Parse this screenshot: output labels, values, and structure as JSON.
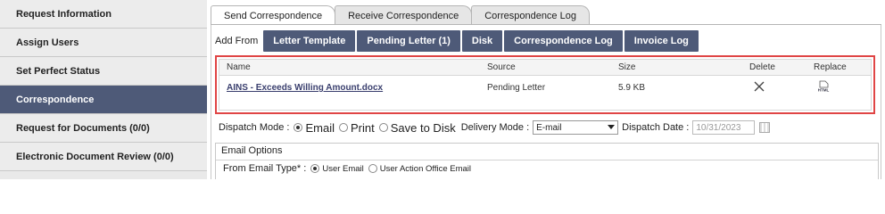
{
  "sidebar": {
    "items": [
      {
        "label": "Request Information"
      },
      {
        "label": "Assign Users"
      },
      {
        "label": "Set Perfect Status"
      },
      {
        "label": "Correspondence"
      },
      {
        "label": "Request for Documents (0/0)"
      },
      {
        "label": "Electronic Document Review (0/0)"
      }
    ],
    "active_index": 3
  },
  "tabs": [
    {
      "label": "Send Correspondence"
    },
    {
      "label": "Receive Correspondence"
    },
    {
      "label": "Correspondence Log"
    }
  ],
  "add_from": {
    "label": "Add From",
    "buttons": [
      {
        "label": "Letter Template"
      },
      {
        "label": "Pending Letter (1)"
      },
      {
        "label": "Disk"
      },
      {
        "label": "Correspondence Log"
      },
      {
        "label": "Invoice Log"
      }
    ]
  },
  "file_table": {
    "headers": {
      "name": "Name",
      "source": "Source",
      "size": "Size",
      "delete": "Delete",
      "replace": "Replace"
    },
    "rows": [
      {
        "name": "AINS - Exceeds Willing Amount.docx",
        "source": "Pending Letter",
        "size": "5.9 KB",
        "replace_icon_text": "HTML"
      }
    ]
  },
  "dispatch": {
    "mode_label": "Dispatch Mode :",
    "modes": [
      "Email",
      "Print",
      "Save to Disk"
    ],
    "selected_mode": "Email",
    "delivery_label": "Delivery Mode :",
    "delivery_value": "E-mail",
    "date_label": "Dispatch Date :",
    "date_value": "10/31/2023"
  },
  "email_options": {
    "title": "Email Options",
    "from_label": "From Email Type* :",
    "types": [
      "User Email",
      "User Action Office Email"
    ],
    "selected_type": "User Email"
  },
  "colors": {
    "accent": "#4e5a78",
    "highlight_border": "#e04545",
    "sidebar_bg": "#ececec"
  }
}
